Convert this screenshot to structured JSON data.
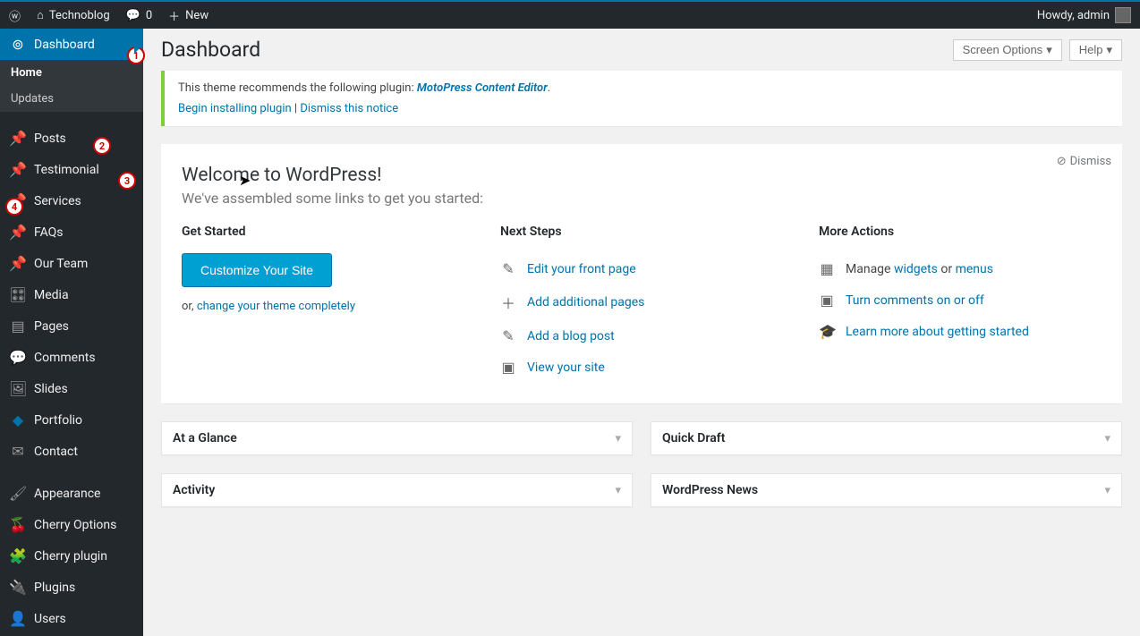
{
  "topbar": {
    "site_name": "Technoblog",
    "comments_count": "0",
    "new_label": "New",
    "howdy": "Howdy, admin"
  },
  "sidebar": {
    "items": [
      {
        "label": "Dashboard",
        "icon": "🏠"
      },
      {
        "label": "Posts",
        "icon": "📌"
      },
      {
        "label": "Testimonial",
        "icon": "📌"
      },
      {
        "label": "Services",
        "icon": "📌"
      },
      {
        "label": "FAQs",
        "icon": "📌"
      },
      {
        "label": "Our Team",
        "icon": "📌"
      },
      {
        "label": "Media",
        "icon": "🎛"
      },
      {
        "label": "Pages",
        "icon": "▤"
      },
      {
        "label": "Comments",
        "icon": "💬"
      },
      {
        "label": "Slides",
        "icon": "🖼"
      },
      {
        "label": "Portfolio",
        "icon": "◆"
      },
      {
        "label": "Contact",
        "icon": "✉"
      },
      {
        "label": "Appearance",
        "icon": "🖌"
      },
      {
        "label": "Cherry Options",
        "icon": "🍒"
      },
      {
        "label": "Cherry plugin",
        "icon": "🧩"
      },
      {
        "label": "Plugins",
        "icon": "🔌"
      },
      {
        "label": "Users",
        "icon": "👤"
      }
    ],
    "sub": {
      "home": "Home",
      "updates": "Updates"
    }
  },
  "badges": {
    "b1": "1",
    "b2": "2",
    "b3": "3",
    "b4": "4"
  },
  "header": {
    "title": "Dashboard",
    "screen_options": "Screen Options",
    "help": "Help"
  },
  "notice": {
    "text_prefix": "This theme recommends the following plugin: ",
    "plugin_name": "MotoPress Content Editor",
    "begin": "Begin installing plugin",
    "sep": " | ",
    "dismiss": "Dismiss this notice"
  },
  "welcome": {
    "title": "Welcome to WordPress!",
    "subtitle": "We've assembled some links to get you started:",
    "dismiss": "Dismiss",
    "col1_title": "Get Started",
    "customize_btn": "Customize Your Site",
    "or_prefix": "or, ",
    "or_link": "change your theme completely",
    "col2_title": "Next Steps",
    "col2_items": [
      {
        "icon": "✎",
        "label": "Edit your front page"
      },
      {
        "icon": "＋",
        "label": "Add additional pages"
      },
      {
        "icon": "✎",
        "label": "Add a blog post"
      },
      {
        "icon": "▣",
        "label": "View your site"
      }
    ],
    "col3_title": "More Actions",
    "col3_manage_prefix": "Manage ",
    "col3_widgets": "widgets",
    "col3_or": " or ",
    "col3_menus": "menus",
    "col3_comments": "Turn comments on or off",
    "col3_learn": "Learn more about getting started"
  },
  "boxes": {
    "glance": "At a Glance",
    "activity": "Activity",
    "quick_draft": "Quick Draft",
    "news": "WordPress News"
  }
}
